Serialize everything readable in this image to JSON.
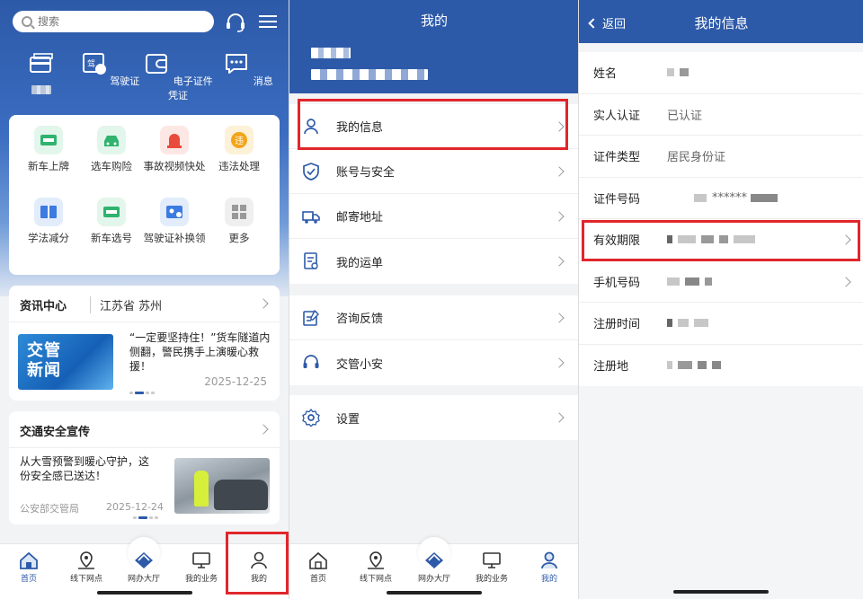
{
  "panel1": {
    "search": {
      "placeholder": "搜索"
    },
    "top_items": [
      {
        "label": "",
        "icon": "license-card-icon"
      },
      {
        "label": "驾驶证",
        "icon": "driving-license-icon"
      },
      {
        "label": "电子证件凭证",
        "icon": "wallet-icon"
      },
      {
        "label": "消息",
        "icon": "message-icon"
      }
    ],
    "services": [
      {
        "label": "新车上牌",
        "icon": "plate-icon",
        "color": "#2fb36e"
      },
      {
        "label": "选车购险",
        "icon": "car-icon",
        "color": "#2fb36e"
      },
      {
        "label": "事故视频快处",
        "icon": "siren-icon",
        "color": "#e84a3c"
      },
      {
        "label": "违法处理",
        "icon": "violation-icon",
        "color": "#f2a51b"
      },
      {
        "label": "学法减分",
        "icon": "book-icon",
        "color": "#3c7be0"
      },
      {
        "label": "新车选号",
        "icon": "plate-select-icon",
        "color": "#2fb36e"
      },
      {
        "label": "驾驶证补换领",
        "icon": "license-renew-icon",
        "color": "#3c7be0"
      },
      {
        "label": "更多",
        "icon": "more-grid-icon",
        "color": "#888888"
      }
    ],
    "news": {
      "title": "资讯中心",
      "location": "江苏省 苏州",
      "image_text": "交管新闻",
      "headline": "“一定要坚持住！”货车隧道内侧翻，警民携手上演暖心救援！",
      "date": "2025-12-25"
    },
    "safety": {
      "title": "交通安全宣传",
      "headline": "从大雪预警到暖心守护，这份安全感已送达！",
      "source": "公安部交管局",
      "date": "2025-12-24"
    }
  },
  "tabs": [
    "首页",
    "线下网点",
    "网办大厅",
    "我的业务",
    "我的"
  ],
  "panel2": {
    "title": "我的",
    "groups": [
      [
        {
          "label": "我的信息",
          "icon": "user-icon"
        },
        {
          "label": "账号与安全",
          "icon": "shield-icon"
        },
        {
          "label": "邮寄地址",
          "icon": "truck-icon"
        },
        {
          "label": "我的运单",
          "icon": "waybill-icon"
        }
      ],
      [
        {
          "label": "咨询反馈",
          "icon": "feedback-icon"
        },
        {
          "label": "交管小安",
          "icon": "headset-icon"
        }
      ],
      [
        {
          "label": "设置",
          "icon": "gear-icon"
        }
      ]
    ]
  },
  "panel3": {
    "back": "返回",
    "title": "我的信息",
    "rows": [
      {
        "key": "姓名",
        "value": "",
        "arrow": false
      },
      {
        "key": "实人认证",
        "value": "已认证",
        "arrow": false
      },
      {
        "key": "证件类型",
        "value": "居民身份证",
        "arrow": false
      },
      {
        "key": "证件号码",
        "value": "******",
        "arrow": false
      },
      {
        "key": "有效期限",
        "value": "",
        "arrow": true
      },
      {
        "key": "手机号码",
        "value": "",
        "arrow": true
      },
      {
        "key": "注册时间",
        "value": "",
        "arrow": false
      },
      {
        "key": "注册地",
        "value": "",
        "arrow": false
      }
    ]
  },
  "colors": {
    "brand": "#2d5aa8",
    "highlight": "#e0262b"
  }
}
